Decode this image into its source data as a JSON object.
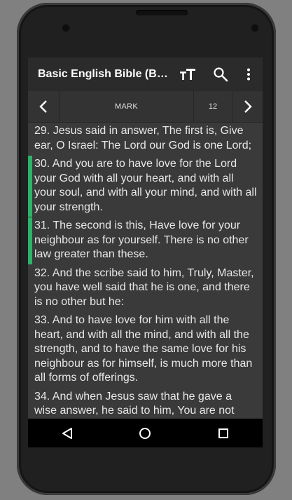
{
  "app": {
    "title": "Basic English Bible (B…"
  },
  "navigation": {
    "book": "MARK",
    "chapter": "12"
  },
  "icons": {
    "font_size": "text-size-icon",
    "search": "search-icon",
    "overflow": "more-vert-icon",
    "prev": "chevron-left-icon",
    "next": "chevron-right-icon",
    "back": "back-triangle-icon",
    "home": "home-circle-icon",
    "recents": "recents-square-icon"
  },
  "colors": {
    "highlight": "#2fb36a",
    "appbar": "#2b2b2b",
    "content_bg": "#3a3a3a"
  },
  "verses": [
    {
      "text": "29. Jesus said in answer, The first is, Give ear, O Israel: The Lord our God is one Lord;",
      "highlighted": false
    },
    {
      "text": "30. And you are to have love for the Lord your God with all your heart, and with all your soul, and with all your mind, and with all your strength.",
      "highlighted": true
    },
    {
      "text": "31. The second is this, Have love for your neighbour as for yourself. There is no other law greater than these.",
      "highlighted": true
    },
    {
      "text": "32. And the scribe said to him, Truly, Master, you have well said that he is one, and there is no other but he:",
      "highlighted": false
    },
    {
      "text": "33. And to have love for him with all the heart, and with all the mind, and with all the strength, and to have the same love for his neighbour as for himself, is much more than all forms of offerings.",
      "highlighted": false
    },
    {
      "text": "34. And when Jesus saw that he gave a wise answer, he said to him, You are not",
      "highlighted": false
    }
  ]
}
